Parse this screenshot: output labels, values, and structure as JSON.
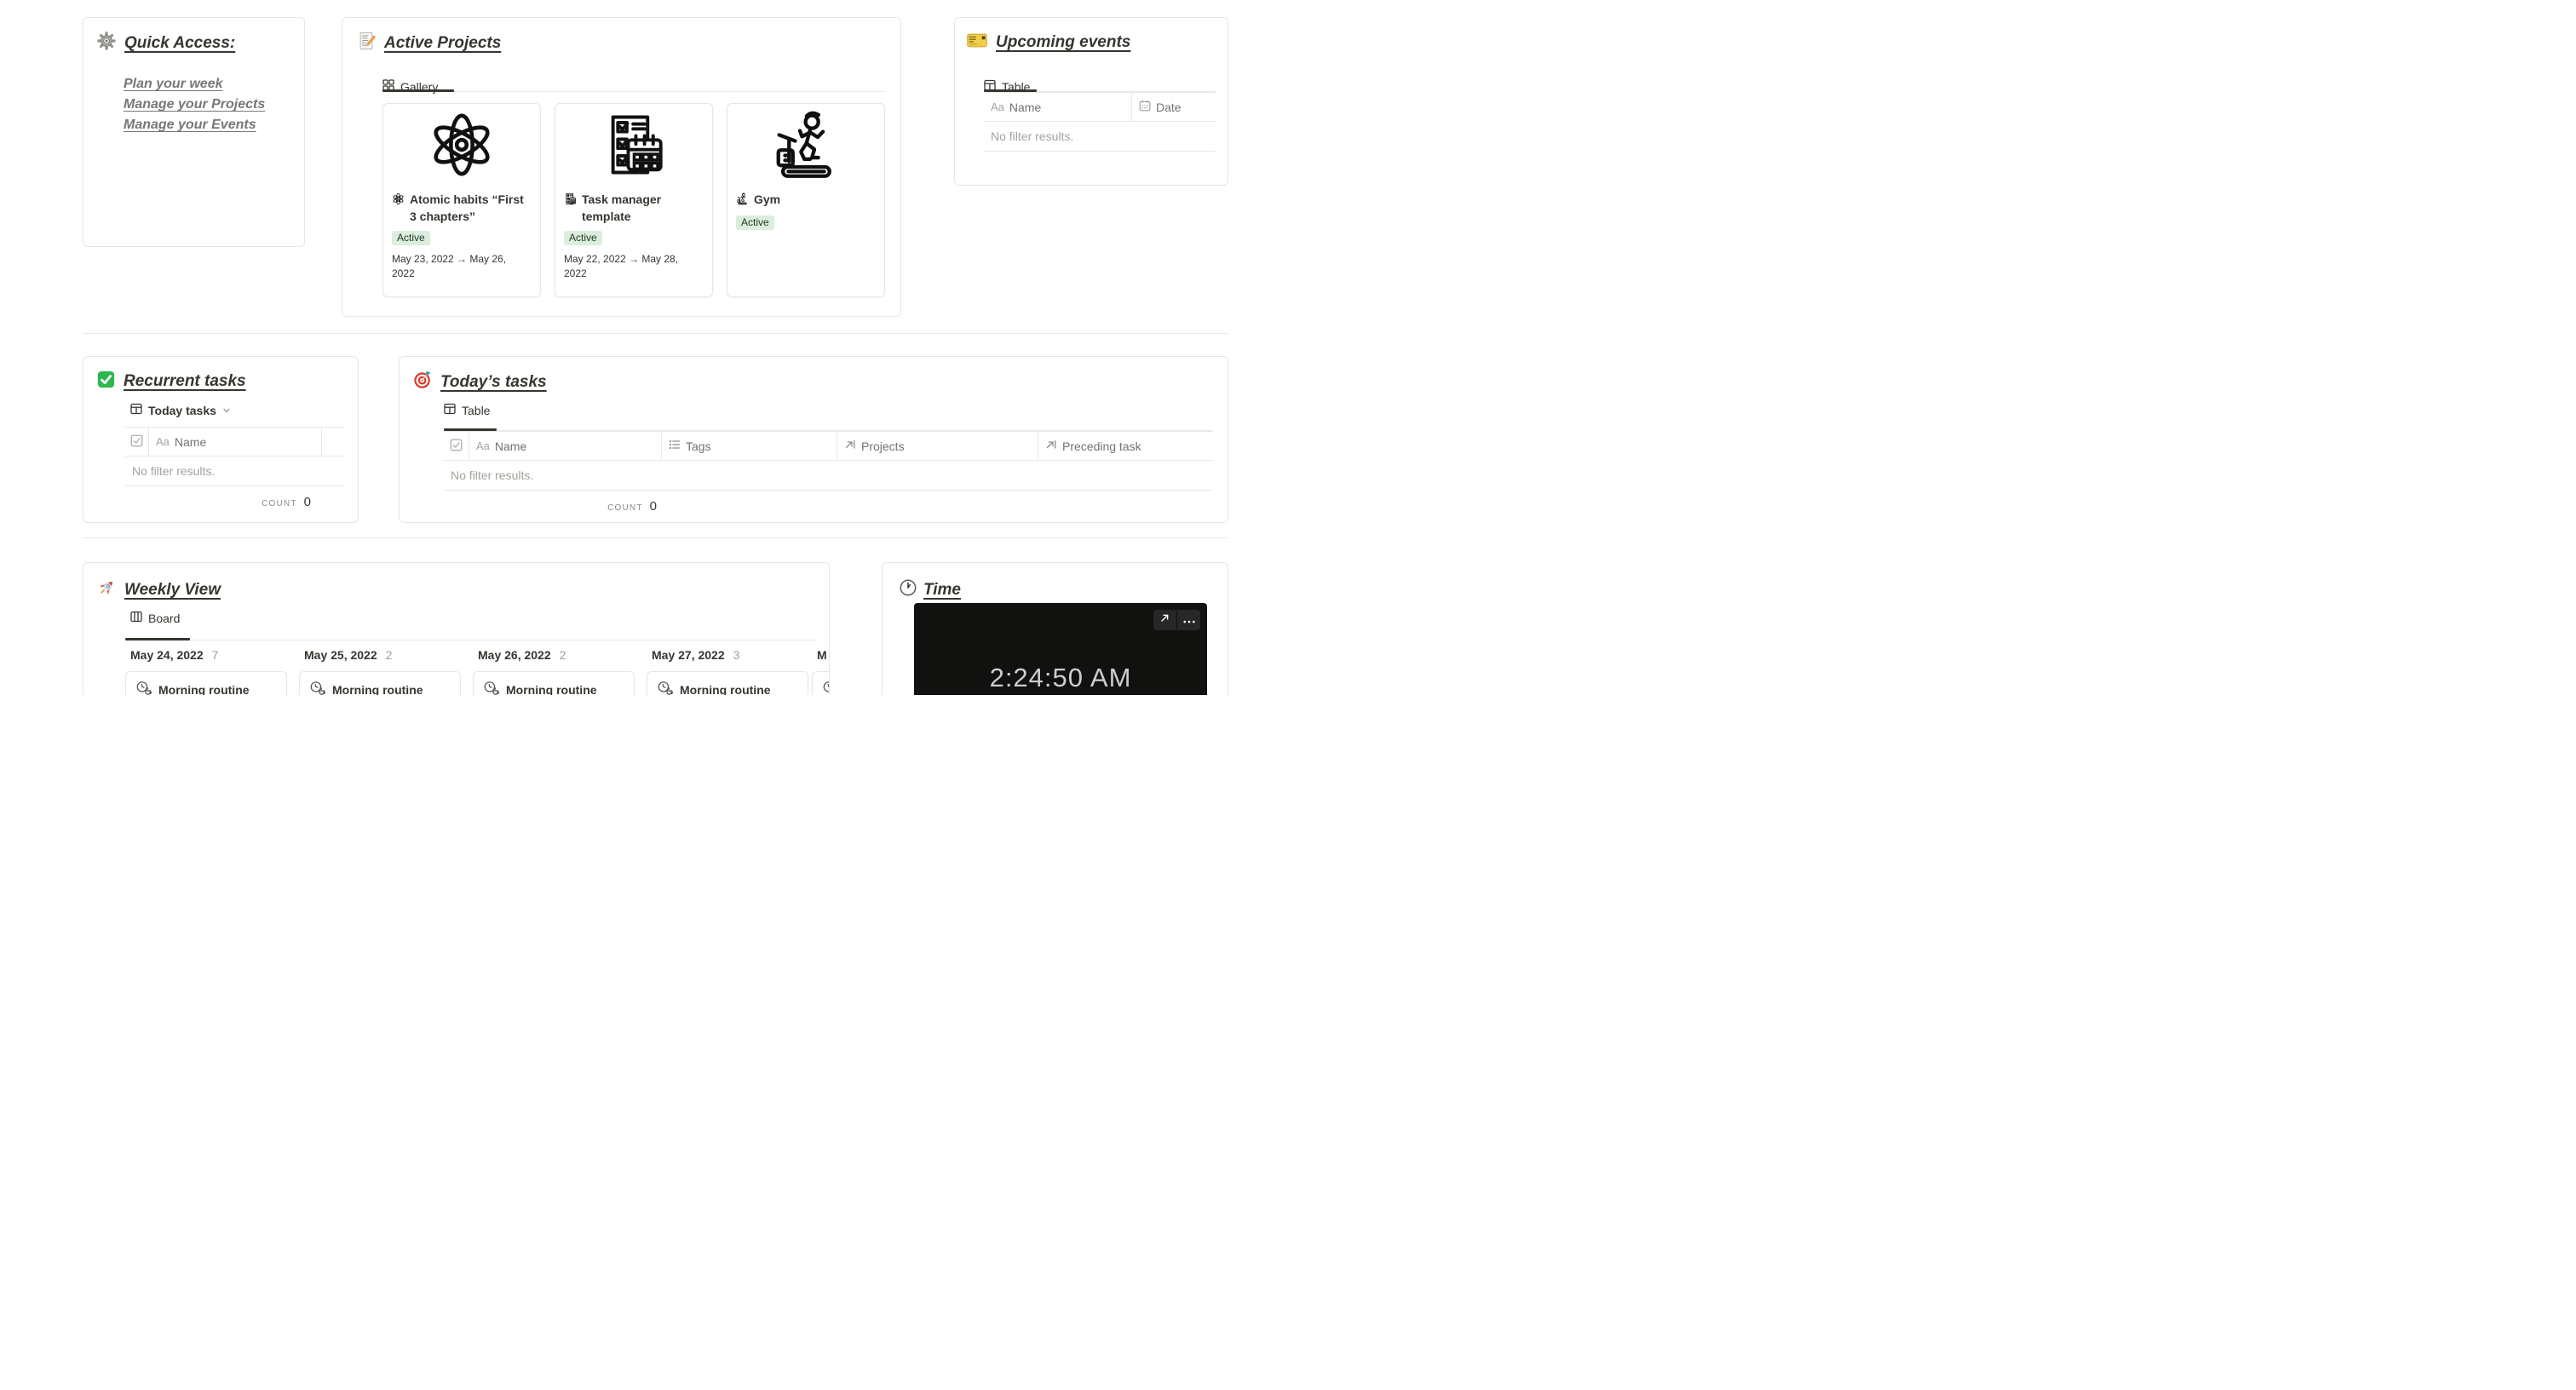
{
  "common": {
    "aa": "Aa"
  },
  "colors": {
    "text_primary": "#37352f",
    "text_muted": "#787774",
    "badge_bg": "#dbeddb",
    "badge_text": "#1c3829",
    "widget_bg": "#111110",
    "widget_text": "#cdcdcd"
  },
  "quick_access": {
    "title": "Quick Access:",
    "links": [
      "Plan your week",
      "Manage your Projects",
      "Manage your Events"
    ]
  },
  "active_projects": {
    "title": "Active Projects",
    "tab": "Gallery",
    "cards": [
      {
        "title": "Atomic habits “First 3 chapters”",
        "status": "Active",
        "dates": "May 23, 2022 → May 26, 2022"
      },
      {
        "title": "Task manager template",
        "status": "Active",
        "dates": "May 22, 2022 → May 28, 2022"
      },
      {
        "title": "Gym",
        "status": "Active",
        "dates": ""
      }
    ]
  },
  "upcoming_events": {
    "title": "Upcoming events",
    "tab": "Table",
    "columns": {
      "name": "Name",
      "date": "Date"
    },
    "empty": "No filter results."
  },
  "recurrent_tasks": {
    "title": "Recurrent tasks",
    "view": "Today tasks",
    "columns": {
      "name": "Name"
    },
    "empty": "No filter results.",
    "count_label": "COUNT",
    "count": "0"
  },
  "todays_tasks": {
    "title": "Today’s tasks",
    "tab": "Table",
    "columns": {
      "name": "Name",
      "tags": "Tags",
      "projects": "Projects",
      "preceding": "Preceding task"
    },
    "empty": "No filter results.",
    "count_label": "COUNT",
    "count": "0"
  },
  "weekly_view": {
    "title": "Weekly View",
    "tab": "Board",
    "columns": [
      {
        "date": "May 24, 2022",
        "count": "7",
        "card": "Morning routine"
      },
      {
        "date": "May 25, 2022",
        "count": "2",
        "card": "Morning routine"
      },
      {
        "date": "May 26, 2022",
        "count": "2",
        "card": "Morning routine"
      },
      {
        "date": "May 27, 2022",
        "count": "3",
        "card": "Morning routine"
      },
      {
        "date": "M",
        "count": "",
        "card": ""
      }
    ]
  },
  "time": {
    "title": "Time",
    "clock": "2:24:50 AM"
  }
}
